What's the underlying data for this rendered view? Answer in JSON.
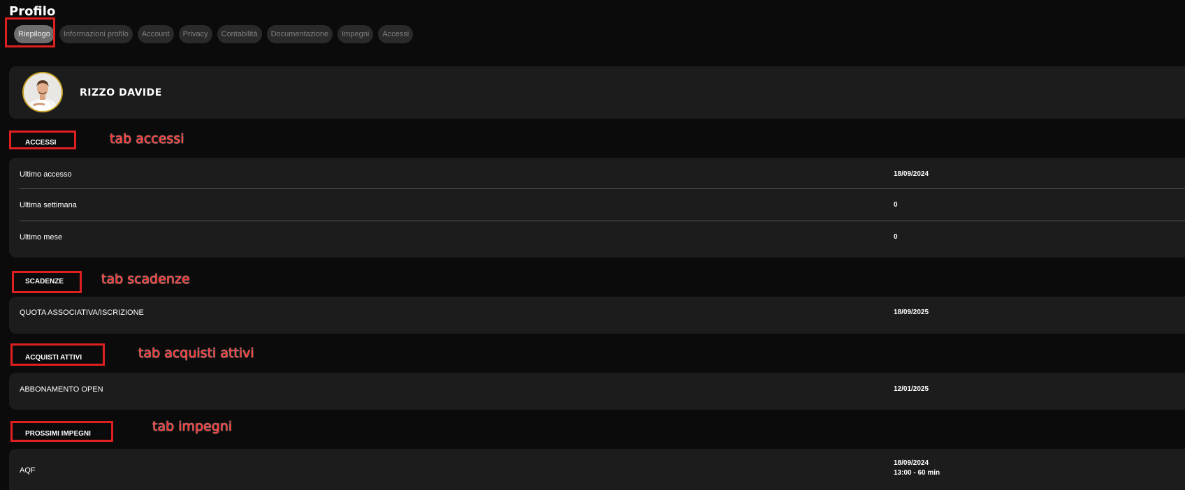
{
  "page": {
    "title": "Profilo"
  },
  "tabs": [
    {
      "label": "Riepilogo",
      "active": true
    },
    {
      "label": "Informazioni profilo",
      "active": false
    },
    {
      "label": "Account",
      "active": false
    },
    {
      "label": "Privacy",
      "active": false
    },
    {
      "label": "Contabilità",
      "active": false
    },
    {
      "label": "Documentazione",
      "active": false
    },
    {
      "label": "Impegni",
      "active": false
    },
    {
      "label": "Accessi",
      "active": false
    }
  ],
  "profile": {
    "name": "RIZZO DAVIDE",
    "avatar_icon": "user-photo-icon"
  },
  "accessi": {
    "header": "ACCESSI",
    "annotation": "tab accessi",
    "rows": [
      {
        "label": "Ultimo accesso",
        "value": "18/09/2024"
      },
      {
        "label": "Ultima settimana",
        "value": "0"
      },
      {
        "label": "Ultimo mese",
        "value": "0"
      }
    ]
  },
  "scadenze": {
    "header": "SCADENZE",
    "annotation": "tab scadenze",
    "rows": [
      {
        "label": "QUOTA ASSOCIATIVA/ISCRIZIONE",
        "value": "18/09/2025"
      }
    ]
  },
  "acquisti": {
    "header": "ACQUISTI ATTIVI",
    "annotation": "tab acquisti attivi",
    "rows": [
      {
        "label": "ABBONAMENTO OPEN",
        "value": "12/01/2025"
      }
    ]
  },
  "impegni": {
    "header": "PROSSIMI IMPEGNI",
    "annotation": "tab impegni",
    "rows": [
      {
        "label": "AQF",
        "value": "18/09/2024",
        "value2": "13:00 - 60 min"
      }
    ]
  },
  "colors": {
    "background": "#0b0b0b",
    "card": "#1c1c1c",
    "tab_bg": "#2a2a2a",
    "tab_active_bg": "#6e6e6e",
    "annotation_red": "#e02020",
    "avatar_ring": "#c9a227"
  }
}
